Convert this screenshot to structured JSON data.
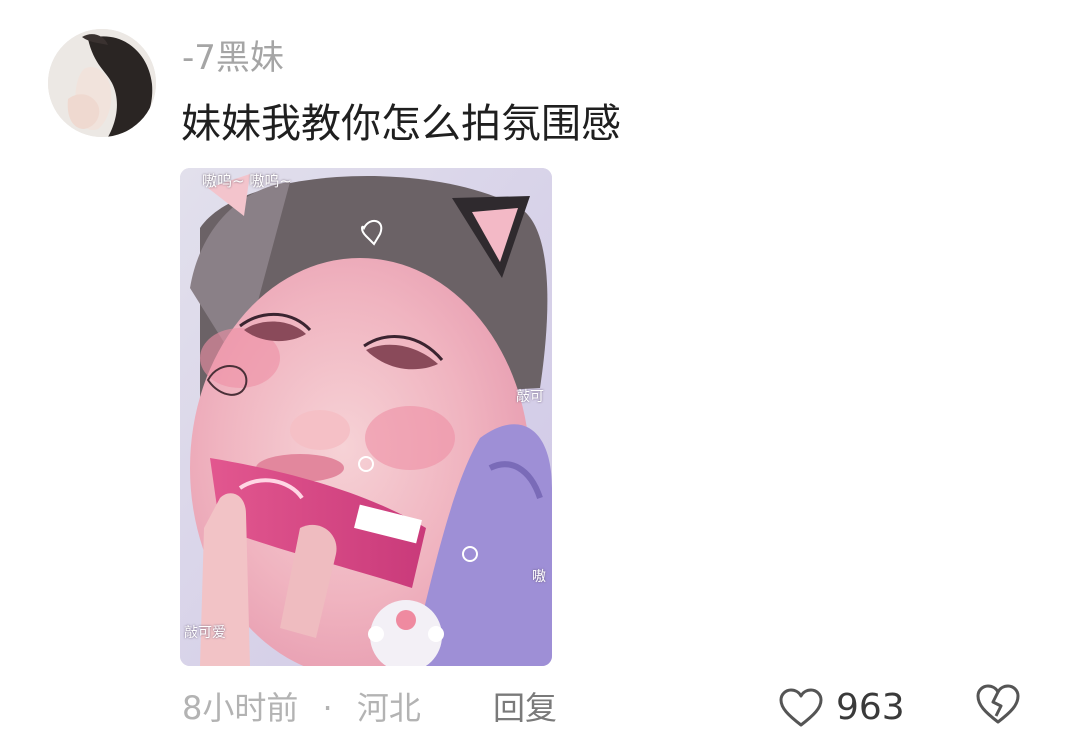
{
  "comment": {
    "username": "-7黑妹",
    "text": "妹妹我教你怎么拍氛围感",
    "avatar_icon": "avatar",
    "image": {
      "caption": "嗷呜~ 嗷呜~",
      "stickers": [
        "敲可",
        "敲可爱",
        "嗷"
      ]
    },
    "meta": {
      "time": "8小时前",
      "separator": "·",
      "location": "河北"
    },
    "reply_label": "回复",
    "like_icon": "heart-icon",
    "like_count": "963",
    "dislike_icon": "broken-heart-icon"
  },
  "colors": {
    "username": "#a5a5a5",
    "text": "#1f1f1f",
    "meta": "#b3b3b3",
    "reply": "#7a7a7a",
    "icon_stroke": "#555555"
  }
}
